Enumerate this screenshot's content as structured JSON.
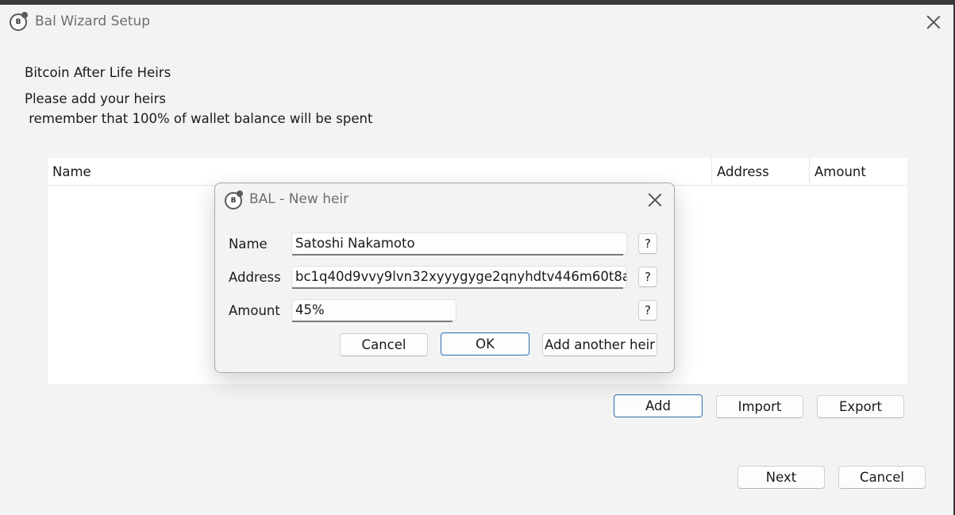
{
  "window": {
    "title": "Bal Wizard Setup",
    "logo_text": "B"
  },
  "wizard": {
    "heading": "Bitcoin After Life Heirs",
    "instruction_line1": "Please add your heirs",
    "instruction_line2": " remember that 100% of wallet balance will be spent"
  },
  "table": {
    "columns": [
      "Name",
      "Address",
      "Amount"
    ]
  },
  "actions": {
    "add": "Add",
    "import": "Import",
    "export": "Export"
  },
  "footer": {
    "next": "Next",
    "cancel": "Cancel"
  },
  "dialog": {
    "title": "BAL - New heir",
    "logo_text": "B",
    "fields": {
      "name_label": "Name",
      "name_value": "Satoshi Nakamoto",
      "address_label": "Address",
      "address_value": "bc1q40d9vvy9lvn32xyyygyge2qnyhdtv446m60t8a",
      "amount_label": "Amount",
      "amount_value": "45%"
    },
    "help_label": "?",
    "buttons": {
      "cancel": "Cancel",
      "ok": "OK",
      "add_another": "Add another heir"
    }
  },
  "colors": {
    "window_bg": "#f3f3f3",
    "accent_border": "#2a6db0",
    "table_bg": "#ffffff"
  }
}
